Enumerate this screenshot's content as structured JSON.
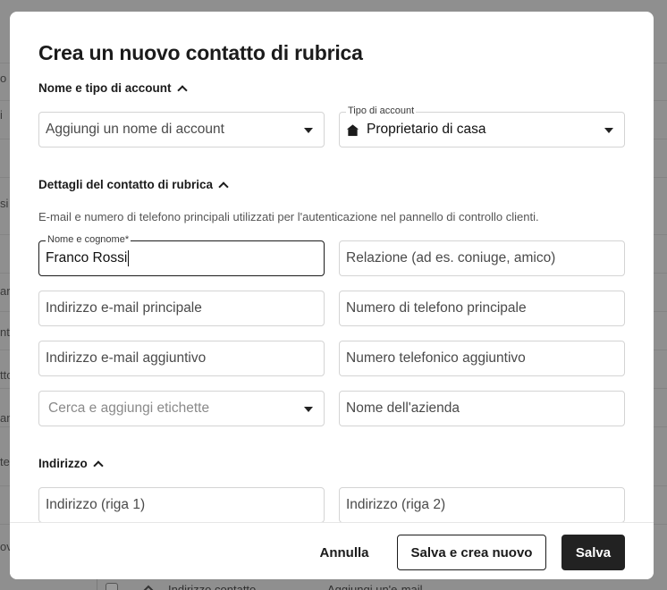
{
  "background": {
    "left_fragments": [
      "o d",
      "i",
      "si",
      "ar",
      "nt",
      "tto",
      "an",
      "te",
      "ov"
    ],
    "bottom_row": {
      "label": "Indirizzo contatto",
      "value": "Aggiungi un'e-mail"
    }
  },
  "modal": {
    "title": "Crea un nuovo contatto di rubrica",
    "account_section": {
      "heading": "Nome e tipo di account",
      "account_name": {
        "placeholder": "Aggiungi un nome di account"
      },
      "account_type": {
        "label": "Tipo di account",
        "value": "Proprietario di casa",
        "icon": "home-icon"
      }
    },
    "details_section": {
      "heading": "Dettagli del contatto di rubrica",
      "helper": "E-mail e numero di telefono principali utilizzati per l'autenticazione nel pannello di controllo clienti.",
      "full_name": {
        "label": "Nome e cognome*",
        "value": "Franco Rossi"
      },
      "relation": {
        "placeholder": "Relazione (ad es. coniuge, amico)"
      },
      "primary_email": {
        "placeholder": "Indirizzo e-mail principale"
      },
      "primary_phone": {
        "placeholder": "Numero di telefono principale"
      },
      "extra_email": {
        "placeholder": "Indirizzo e-mail aggiuntivo"
      },
      "extra_phone": {
        "placeholder": "Numero telefonico aggiuntivo"
      },
      "tags": {
        "placeholder": "Cerca e aggiungi etichette"
      },
      "company": {
        "placeholder": "Nome dell'azienda"
      }
    },
    "address_section": {
      "heading": "Indirizzo",
      "line1": {
        "placeholder": "Indirizzo (riga 1)"
      },
      "line2": {
        "placeholder": "Indirizzo (riga 2)"
      }
    },
    "footer": {
      "cancel": "Annulla",
      "save_new": "Salva e crea nuovo",
      "save": "Salva"
    }
  }
}
